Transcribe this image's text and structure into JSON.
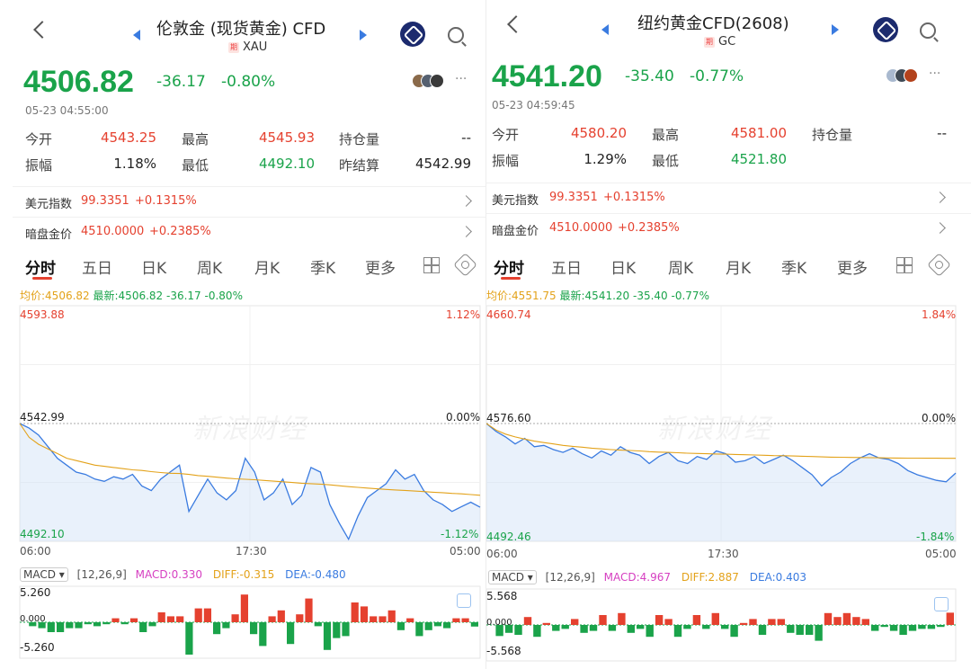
{
  "colors": {
    "up": "#e5412f",
    "down": "#1aa34a",
    "price_line": "#3a7be0",
    "avg_line": "#e3a21a",
    "fill": "#cfe0f7"
  },
  "panels": [
    {
      "nav": {
        "title": "伦敦金 (现货黄金) CFD",
        "badge": "期",
        "code": "XAU"
      },
      "price": "4506.82",
      "change": "-36.17",
      "change_pct": "-0.80%",
      "datetime": "05-23 04:55:00",
      "more": "···",
      "quote_labels": {
        "open": "今开",
        "high": "最高",
        "oi": "持仓量",
        "amp": "振幅",
        "low": "最低",
        "prev_settle": "昨结算"
      },
      "quote_values": {
        "open": "4543.25",
        "high": "4545.93",
        "oi": "--",
        "amp": "1.18%",
        "low": "4492.10",
        "prev_settle": "4542.99"
      },
      "indices": [
        {
          "name": "美元指数",
          "value": "99.3351",
          "change": "+0.1315%"
        },
        {
          "name": "暗盘金价",
          "value": "4510.0000",
          "change": "+0.2385%"
        }
      ],
      "tabs": [
        "分时",
        "五日",
        "日K",
        "周K",
        "月K",
        "季K",
        "更多"
      ],
      "legend": {
        "avg": "均价:4506.82",
        "latest": "最新:4506.82",
        "change": "-36.17",
        "change_pct": "-0.80%"
      },
      "chart_data": {
        "type": "line",
        "y_top": "4593.88",
        "y_mid": "4542.99",
        "y_bottom": "4492.10",
        "pct_top": "1.12%",
        "pct_mid": "0.00%",
        "pct_bottom": "-1.12%",
        "ylim": [
          4492.1,
          4593.88
        ],
        "x_labels": [
          "06:00",
          "17:30",
          "05:00"
        ],
        "price": [
          4542.99,
          4541,
          4538,
          4533,
          4528,
          4525,
          4522,
          4521,
          4519,
          4518,
          4520,
          4519,
          4521,
          4516,
          4514,
          4519,
          4522,
          4525,
          4505,
          4512,
          4519,
          4513,
          4510,
          4514,
          4528,
          4522,
          4510,
          4513,
          4519,
          4508,
          4512,
          4524,
          4522,
          4508,
          4500,
          4493,
          4503,
          4511,
          4514,
          4517,
          4523,
          4519,
          4521,
          4514,
          4510,
          4508,
          4505,
          4507,
          4509,
          4506.82
        ],
        "avg": [
          4542.99,
          4537,
          4534,
          4532,
          4530,
          4528,
          4527,
          4526,
          4525,
          4524.5,
          4524,
          4523.5,
          4523,
          4522.7,
          4522.2,
          4521.8,
          4521.5,
          4521.4,
          4521,
          4520.5,
          4520.2,
          4519.8,
          4519.4,
          4519.1,
          4518.9,
          4518.7,
          4518.4,
          4518.1,
          4517.8,
          4517.5,
          4517.2,
          4517,
          4516.8,
          4516.5,
          4516.1,
          4515.7,
          4515.4,
          4515.1,
          4514.8,
          4514.5,
          4514.3,
          4514.1,
          4513.8,
          4513.6,
          4513.3,
          4513.1,
          4512.8,
          4512.6,
          4512.3,
          4512
        ],
        "macd": {
          "label": "MACD",
          "params": "[12,26,9]",
          "macd": "MACD:0.330",
          "diff": "DIFF:-0.315",
          "dea": "DEA:-0.480",
          "top": "5.260",
          "bottom": "-5.260",
          "zero": "0.000"
        }
      }
    },
    {
      "nav": {
        "title": "纽约黄金CFD(2608)",
        "badge": "期",
        "code": "GC"
      },
      "price": "4541.20",
      "change": "-35.40",
      "change_pct": "-0.77%",
      "datetime": "05-23 04:59:45",
      "more": "···",
      "quote_labels": {
        "open": "今开",
        "high": "最高",
        "oi": "持仓量",
        "amp": "振幅",
        "low": "最低"
      },
      "quote_values": {
        "open": "4580.20",
        "high": "4581.00",
        "oi": "--",
        "amp": "1.29%",
        "low": "4521.80"
      },
      "indices": [
        {
          "name": "美元指数",
          "value": "99.3351",
          "change": "+0.1315%"
        },
        {
          "name": "暗盘金价",
          "value": "4510.0000",
          "change": "+0.2385%"
        }
      ],
      "tabs": [
        "分时",
        "五日",
        "日K",
        "周K",
        "月K",
        "季K",
        "更多"
      ],
      "legend": {
        "avg": "均价:4551.75",
        "latest": "最新:4541.20",
        "change": "-35.40",
        "change_pct": "-0.77%"
      },
      "chart_data": {
        "type": "line",
        "y_top": "4660.74",
        "y_mid": "4576.60",
        "y_bottom": "4492.46",
        "pct_top": "1.84%",
        "pct_mid": "0.00%",
        "pct_bottom": "-1.84%",
        "ylim": [
          4492.46,
          4660.74
        ],
        "x_labels": [
          "06:00",
          "17:30",
          "05:00"
        ],
        "price": [
          4576.6,
          4571,
          4567,
          4562,
          4566,
          4560,
          4561,
          4558,
          4556,
          4559,
          4555,
          4552,
          4557,
          4554,
          4560,
          4556,
          4554,
          4548,
          4553,
          4556,
          4550,
          4548,
          4553,
          4551,
          4557,
          4555,
          4549,
          4550,
          4553,
          4548,
          4551,
          4554,
          4550,
          4545,
          4540,
          4532,
          4538,
          4542,
          4548,
          4552,
          4555,
          4552,
          4551,
          4548,
          4543,
          4540,
          4538,
          4536,
          4535,
          4541.2
        ],
        "avg": [
          4576.6,
          4572,
          4569,
          4567,
          4565.5,
          4564,
          4563,
          4562,
          4561,
          4560.3,
          4559.7,
          4559,
          4558.5,
          4558,
          4557.6,
          4557.3,
          4557,
          4556.5,
          4556.2,
          4556,
          4555.7,
          4555.4,
          4555.2,
          4555,
          4554.8,
          4554.7,
          4554.5,
          4554.3,
          4554.1,
          4553.9,
          4553.7,
          4553.6,
          4553.4,
          4553.2,
          4553,
          4552.8,
          4552.6,
          4552.5,
          4552.4,
          4552.3,
          4552.2,
          4552.1,
          4552,
          4551.95,
          4551.9,
          4551.85,
          4551.8,
          4551.78,
          4551.76,
          4551.75
        ],
        "macd": {
          "label": "MACD",
          "params": "[12,26,9]",
          "macd": "MACD:4.967",
          "diff": "DIFF:2.887",
          "dea": "DEA:0.403",
          "top": "5.568",
          "bottom": "-5.568",
          "zero": "0.000"
        }
      }
    }
  ]
}
